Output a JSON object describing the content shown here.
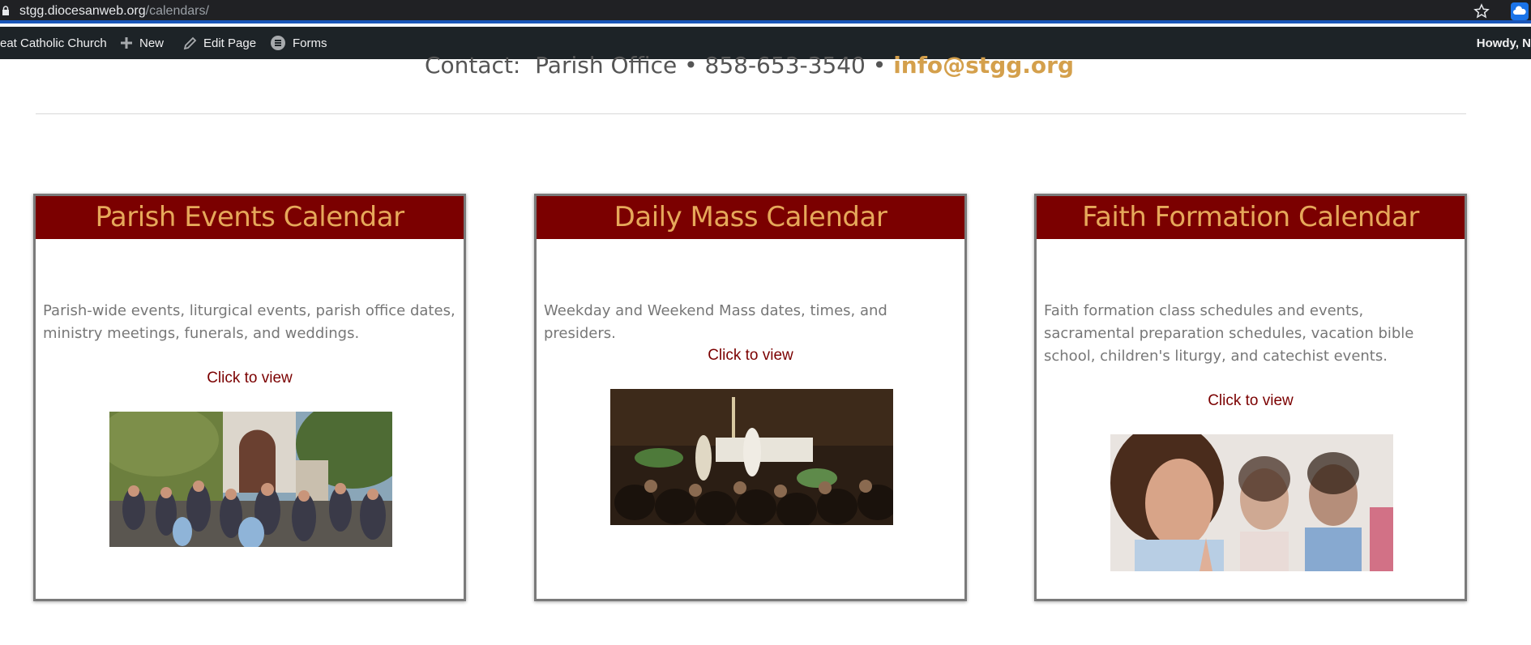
{
  "browser": {
    "url_host": "stgg.diocesanweb.org",
    "url_path": "/calendars/"
  },
  "admin_bar": {
    "site_name": "eat Catholic Church",
    "new_label": "New",
    "edit_label": "Edit Page",
    "forms_label": "Forms",
    "howdy": "Howdy, N"
  },
  "contact": {
    "prefix": "Contact:  Parish Office • 858-653-3540 • ",
    "email": "info@stgg.org"
  },
  "cards": [
    {
      "title": "Parish Events Calendar",
      "description": "Parish-wide events, liturgical events, parish office dates, ministry meetings, funerals, and weddings.",
      "link": "Click to view"
    },
    {
      "title": "Daily Mass Calendar",
      "description": "Weekday and Weekend Mass dates, times, and presiders.",
      "link": "Click to view"
    },
    {
      "title": "Faith Formation Calendar",
      "description": "Faith formation class schedules and events, sacramental preparation schedules, vacation bible school, children's liturgy, and catechist events.",
      "link": "Click to view"
    }
  ],
  "colors": {
    "header_bg": "#7b0000",
    "header_text": "#e6a85a",
    "link": "#7b0000",
    "email": "#d4a04c"
  }
}
